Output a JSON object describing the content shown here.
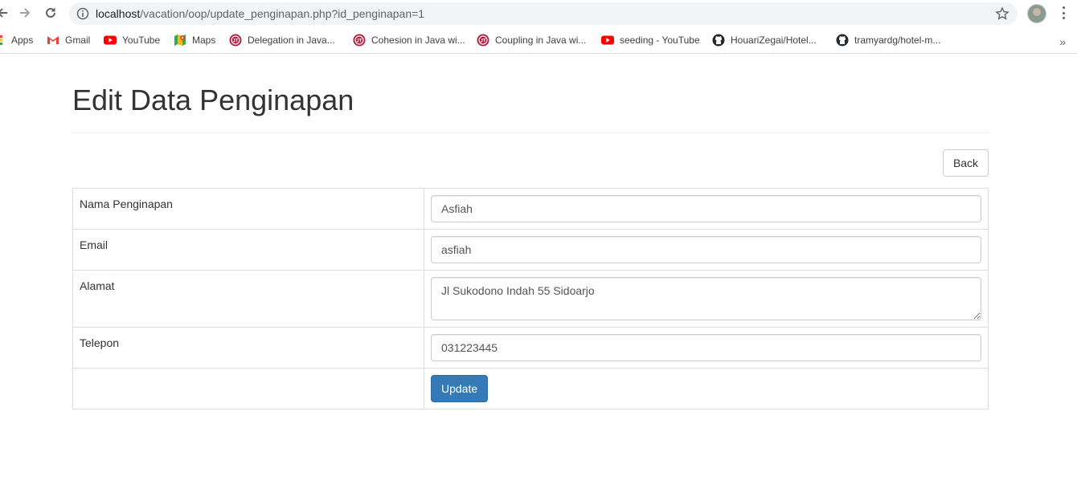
{
  "browser": {
    "url_host": "localhost",
    "url_path": "/vacation/oop/update_penginapan.php?id_penginapan=1",
    "bookmarks": [
      {
        "label": "Apps",
        "icon": "apps-grid-icon"
      },
      {
        "label": "Gmail",
        "icon": "gmail-icon"
      },
      {
        "label": "YouTube",
        "icon": "youtube-icon"
      },
      {
        "label": "Maps",
        "icon": "maps-icon"
      },
      {
        "label": "Delegation in Java...",
        "icon": "site-icon"
      },
      {
        "label": "Cohesion in Java wi...",
        "icon": "site-icon"
      },
      {
        "label": "Coupling in Java wi...",
        "icon": "site-icon"
      },
      {
        "label": "seeding - YouTube",
        "icon": "youtube-icon"
      },
      {
        "label": "HouariZegai/Hotel...",
        "icon": "github-icon"
      },
      {
        "label": "tramyardg/hotel-m...",
        "icon": "github-icon"
      }
    ],
    "more_bookmarks": "»"
  },
  "page": {
    "title": "Edit Data Penginapan",
    "back_label": "Back",
    "fields": [
      {
        "label": "Nama Penginapan",
        "value": "Asfiah"
      },
      {
        "label": "Email",
        "value": "asfiah"
      },
      {
        "label": "Alamat",
        "value": "Jl Sukodono Indah 55 Sidoarjo"
      },
      {
        "label": "Telepon",
        "value": "031223445"
      }
    ],
    "update_label": "Update"
  },
  "colors": {
    "primary": "#337ab7",
    "youtube": "#ff0000",
    "site_icon": "#b5193c",
    "github": "#24292e"
  }
}
